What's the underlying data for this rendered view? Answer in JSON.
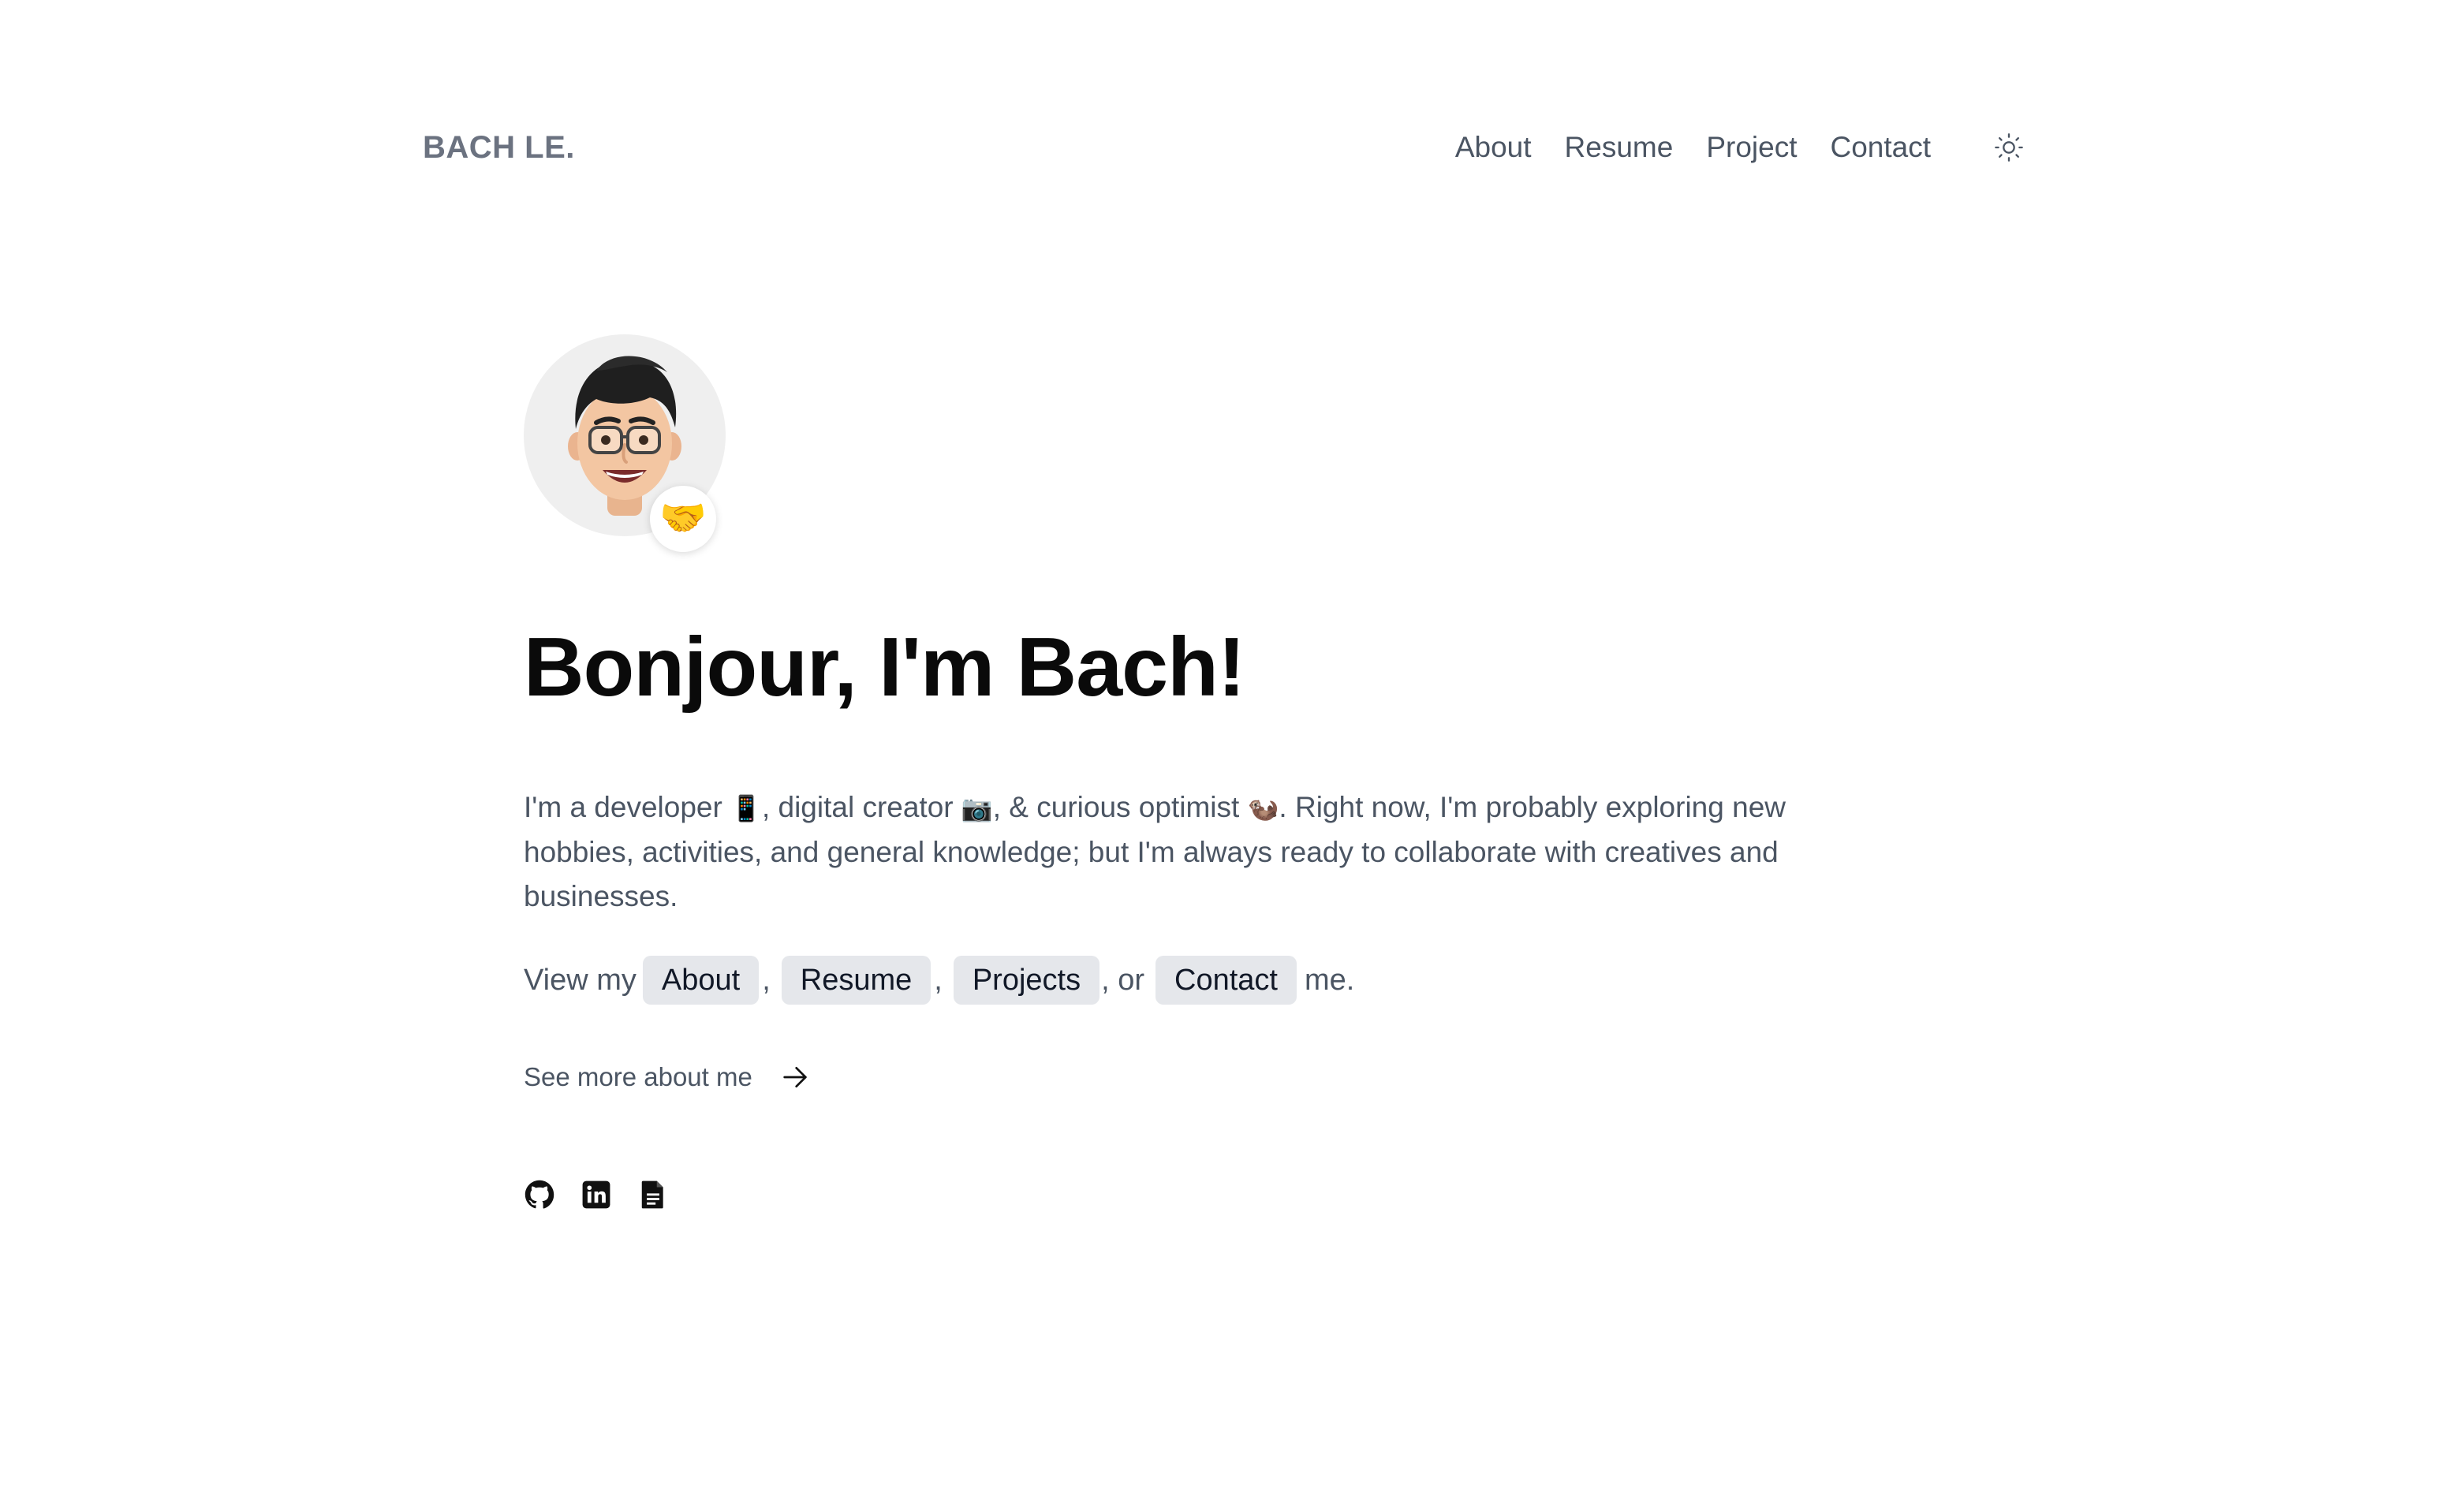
{
  "header": {
    "brand": "BACH LE.",
    "nav": [
      {
        "label": "About"
      },
      {
        "label": "Resume"
      },
      {
        "label": "Project"
      },
      {
        "label": "Contact"
      }
    ],
    "theme_icon": "sun-icon"
  },
  "hero": {
    "avatar_icon": "memoji-avatar",
    "badge_emoji": "🤝",
    "title": "Bonjour, I'm Bach!",
    "bio": {
      "part1": "I'm a developer ",
      "emoji1": "📱",
      "part2": ", digital creator ",
      "emoji2": "📷",
      "part3": ", & curious optimist ",
      "emoji3": "🦦",
      "part4": ". Right now, I'm probably exploring new hobbies, activities, and general knowledge; but I'm always ready to collaborate with creatives and businesses."
    },
    "view_line": {
      "prefix": "View my",
      "about": "About",
      "comma1": ",",
      "resume": "Resume",
      "comma2": ",",
      "projects": "Projects",
      "or": ", or",
      "contact": "Contact",
      "suffix": "me."
    },
    "see_more": "See more about me",
    "socials": [
      {
        "icon": "github-icon"
      },
      {
        "icon": "linkedin-icon"
      },
      {
        "icon": "document-icon"
      }
    ]
  },
  "colors": {
    "text": "#4b5563",
    "heading": "#0a0a0a",
    "chip_bg": "#e5e7eb",
    "avatar_bg": "#efefef"
  }
}
